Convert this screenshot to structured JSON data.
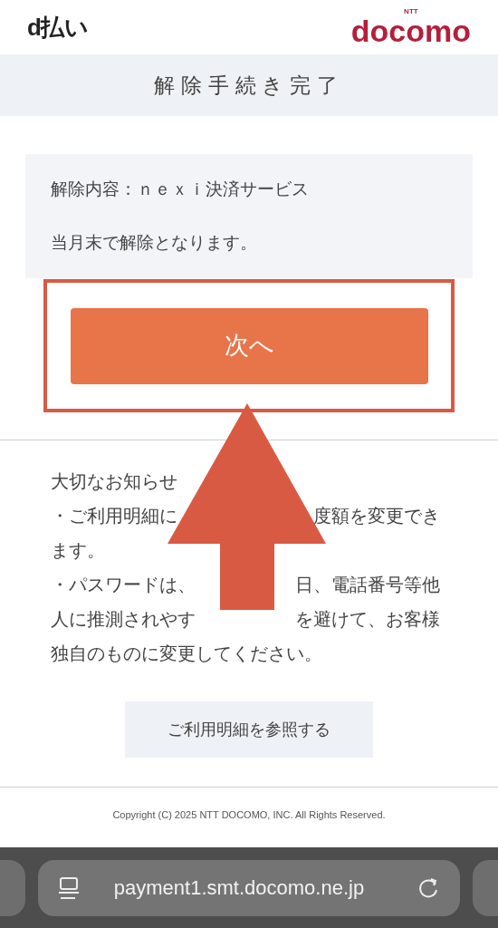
{
  "header": {
    "service_logo": "d払い",
    "brand_small": "NTT",
    "brand_logo": "docomo"
  },
  "title": "解除手続き完了",
  "info": [
    "解除内容：ｎｅｘｉ決済サービス",
    "当月末で解除となります。"
  ],
  "next_button": "次へ",
  "notice": {
    "heading": "大切なお知らせ",
    "lines": [
      [
        "・ご利用明細に",
        "度額を変更でき"
      ],
      [
        "ます。"
      ],
      [
        "・パスワードは、",
        "日、電話番号等他"
      ],
      [
        "人に推測されやす",
        "を避けて、お客様"
      ],
      [
        "独自のものに変更してください。"
      ]
    ]
  },
  "statement_button": "ご利用明細を参照する",
  "copyright": "Copyright (C) 2025 NTT DOCOMO, INC. All Rights Reserved.",
  "browser": {
    "url": "payment1.smt.docomo.ne.jp"
  }
}
